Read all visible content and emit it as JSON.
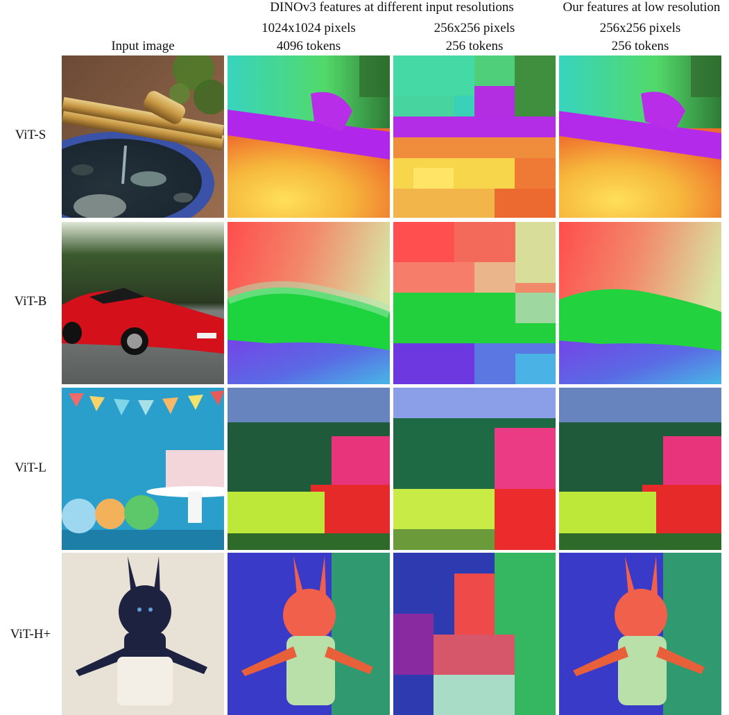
{
  "header": {
    "group_dinov3": "DINOv3 features at different input resolutions",
    "group_ours": "Our features at low resolution",
    "col_input": "Input image",
    "col_hr_pixels": "1024x1024 pixels",
    "col_hr_tokens": "4096 tokens",
    "col_lr_pixels": "256x256 pixels",
    "col_lr_tokens": "256 tokens",
    "col_ours_pixels": "256x256 pixels",
    "col_ours_tokens": "256 tokens"
  },
  "rows": [
    {
      "label": "ViT-S"
    },
    {
      "label": "ViT-B"
    },
    {
      "label": "ViT-L"
    },
    {
      "label": "ViT-H+"
    }
  ]
}
